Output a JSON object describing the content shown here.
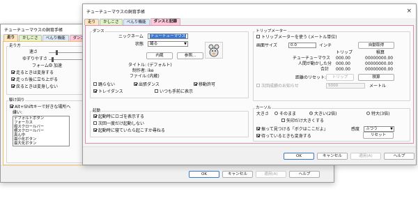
{
  "back_window": {
    "title": "チューチューマウスの飼育手帳",
    "tabs": [
      "走り",
      "かしこさ",
      "べんり機能",
      "ダンスと"
    ],
    "running": {
      "group_title": "走り方",
      "speed_label": "速さ",
      "wobble_label": "ゆずりやすさ",
      "form_label": "フォーム",
      "form_value": "加速",
      "checks": [
        "走るときは変身する",
        "走った後に立ち上がる",
        "戻るときは変身しない"
      ]
    },
    "drill": {
      "group_title": "駆け回り",
      "check": "Alt+Shiftキーで好きな場所へ",
      "list_label": "嫌い:",
      "items": [
        "デフォルトボタン",
        "フォーカス",
        "縦スクロールバー",
        "横スクロールバー",
        "真ん中",
        "最小化ボタン",
        "最大化ボタン"
      ]
    },
    "buttons": {
      "ok": "OK",
      "cancel": "キャンセル",
      "apply": "適用(A)",
      "help": "ヘルプ"
    }
  },
  "front_window": {
    "title": "チューチューマウスの飼育手帳",
    "close": "×",
    "tabs": [
      {
        "label": "走り",
        "color": "#ffe6bf"
      },
      {
        "label": "かしこさ",
        "color": "#e2f3c8"
      },
      {
        "label": "べんり機能",
        "color": "#dbeafb"
      },
      {
        "label": "ダンスと記録",
        "color": "#ffc9db"
      }
    ],
    "dance": {
      "group_title": "ダンス",
      "nickname_label": "ニックネーム",
      "nickname_value": "チューチューマウス",
      "state_label": "状態",
      "state_value": "踊る",
      "btn_builtin": "内蔵",
      "btn_browse": "参照...",
      "title_label": "タイトル:",
      "title_value": "(デフォルト)",
      "author_label": "制作者:",
      "author_value": "ike",
      "file_label": "ファイル:",
      "file_value": "(内蔵)",
      "checks": [
        {
          "label": "踊らない",
          "checked": false
        },
        {
          "label": "出張ダンス",
          "checked": true
        },
        {
          "label": "移動許可",
          "checked": true
        },
        {
          "label": "トレイダンス",
          "checked": true
        },
        {
          "label": "いつも手前に表示",
          "checked": false
        }
      ]
    },
    "startup": {
      "group_title": "起動",
      "checks": [
        {
          "label": "起動時にロゴを表示する",
          "checked": true
        },
        {
          "label": "次回一度だけ起動しない",
          "checked": false
        },
        {
          "label": "起動時に寝ていたら起こすか尋ねる",
          "checked": true
        }
      ]
    },
    "tripmeter": {
      "group_title": "トリップメーター",
      "check": "トリップメーターを使う (メートル単位)",
      "screen_label": "画面サイズ",
      "screen_value": "0.0",
      "screen_unit": "インチ",
      "btn_auto": "自動取得",
      "col_trip": "トリップ",
      "col_total": "積算",
      "rows": [
        {
          "label": "チューチューマウス",
          "trip": "000.00",
          "total": "00000000.00"
        },
        {
          "label": "人間が動かした分",
          "trip": "000.00",
          "total": "00000000.00"
        },
        {
          "label": "合計",
          "trip": "000.00",
          "total": "00000000.00"
        }
      ],
      "reset_label": "距離のリセット:",
      "btn_trip": "トリップ",
      "btn_total": "積算",
      "notify_label": "次回成績のお知らせ",
      "notify_value": "5000",
      "notify_unit": "メートル"
    },
    "cursor": {
      "group_title": "カーソル",
      "size_label": "大きさ",
      "sizes": [
        {
          "label": "そのまま",
          "selected": false
        },
        {
          "label": "大きい(2倍)",
          "selected": true
        },
        {
          "label": "特大(3倍)",
          "selected": false
        }
      ],
      "arrow_check": "矢印だけ大きくする",
      "shake_check": "振って見つける「ボクはここだよ」",
      "sensitivity_label": "感度",
      "sensitivity_value": "ふつう",
      "wait_check": "待っているときも変身する",
      "btn_reset": "リセット"
    },
    "buttons": {
      "ok": "OK",
      "cancel": "キャンセル",
      "apply": "適用(A)",
      "help": "ヘルプ"
    }
  }
}
